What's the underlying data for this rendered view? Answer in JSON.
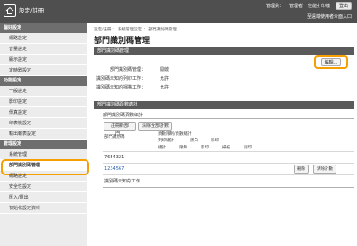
{
  "header": {
    "app_title": "設定/註冊",
    "user_label": "管理員：",
    "user_name": "管理者",
    "device_name": "佳能打印機",
    "logout_label": "登出",
    "sub_link": "至遠端使用者介面入口"
  },
  "sidebar": {
    "sections": [
      {
        "title": "偏好設定",
        "items": [
          "網路設定",
          "音量設定",
          "顯示設定",
          "定時器設定"
        ]
      },
      {
        "title": "功能設定",
        "items": [
          "一般設定",
          "影印設定",
          "傳真設定",
          "印表機設定",
          "輸出報表設定"
        ]
      },
      {
        "title": "管理設定",
        "items": [
          "系統管理",
          "部門識別碼管理",
          "網路設定",
          "安全性設定",
          "匯入/匯出",
          "初始化設定資料"
        ]
      }
    ],
    "active_item": "部門識別碼管理"
  },
  "main": {
    "breadcrumb": "設定/註冊 ： 系統管理設定 ： 部門識別碼管理",
    "title": "部門識別碼管理",
    "section1": "部門識別碼管理",
    "edit_label": "編輯...",
    "settings": [
      {
        "label": "部門識別碼管理：",
        "value": "開啟"
      },
      {
        "label": "識別碼未知的列印工作：",
        "value": "允許"
      },
      {
        "label": "識別碼未知的掃描工作：",
        "value": "允許"
      }
    ],
    "section2": "部門識別碼頁數總計",
    "subsection": "部門識別碼頁數總計",
    "register_label": "註冊新部門...",
    "clear_all_label": "清除全部計數",
    "table": {
      "col_id": "部門識別碼",
      "group_header": "頁數限制/頁數總計",
      "col_print": "列印總計",
      "col_bw": "黑白",
      "col_copy": "影印",
      "col_scan": "掃描",
      "col_total": "總計",
      "col_limit": "限制",
      "col_print2": "列印",
      "rows": [
        {
          "id": "7654321",
          "link": false
        },
        {
          "id": "1234567",
          "link": true
        },
        {
          "id": "識別碼未知的工作",
          "link": false
        }
      ],
      "delete_label": "刪除",
      "clear_label": "清除計數"
    }
  }
}
